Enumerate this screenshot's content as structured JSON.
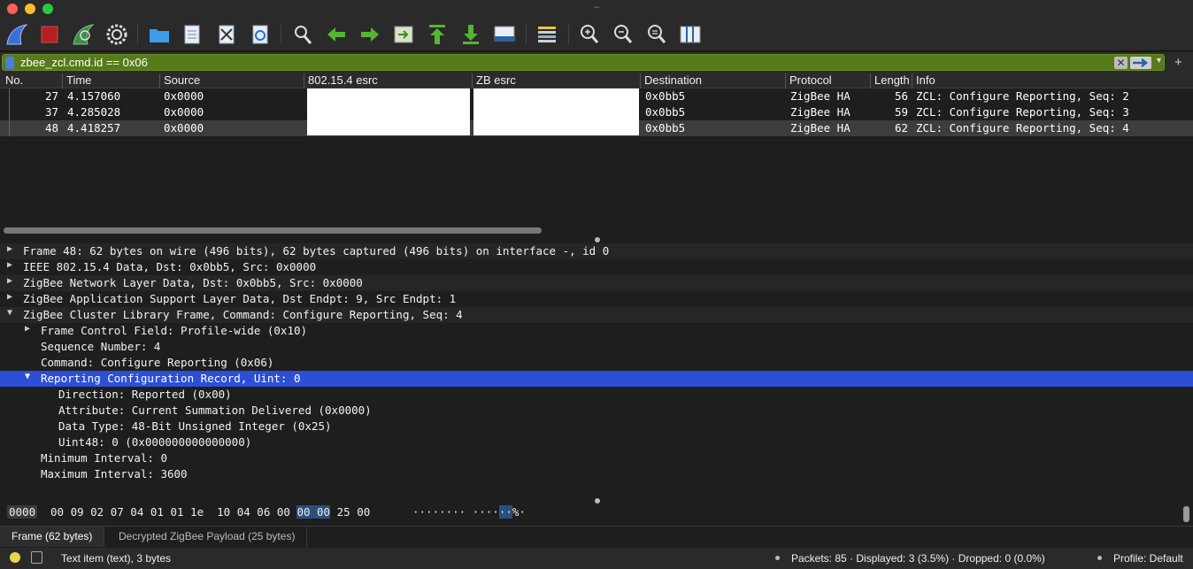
{
  "window": {
    "title": "–"
  },
  "toolbar": {
    "icons": [
      "shark-fin-start-icon",
      "stop-square-icon",
      "shark-fin-restart-icon",
      "gear-icon",
      "folder-open-icon",
      "file-icon",
      "close-file-icon",
      "reload-file-icon",
      "search-icon",
      "arrow-left-icon",
      "arrow-right-icon",
      "go-to-packet-icon",
      "arrow-up-first-icon",
      "arrow-down-last-icon",
      "autoscroll-icon",
      "colorize-icon",
      "zoom-in-icon",
      "zoom-out-icon",
      "zoom-reset-icon",
      "resize-columns-icon"
    ],
    "accent_colors": {
      "fin": "#3b6fd6",
      "stop": "#b32020",
      "green_fin": "#3f8d4a",
      "arrow_green": "#55b534"
    }
  },
  "filter": {
    "value": "zbee_zcl.cmd.id == 0x06",
    "clear_glyph": "✕",
    "add_glyph": "+"
  },
  "packet_list": {
    "columns": [
      "No.",
      "Time",
      "Source",
      "802.15.4 esrc",
      "ZB esrc",
      "Destination",
      "Protocol",
      "Length",
      "Info"
    ],
    "rows": [
      {
        "no": "27",
        "time": "4.157060",
        "source": "0x0000",
        "esrc": "",
        "zbesrc": "",
        "destination": "0x0bb5",
        "protocol": "ZigBee HA",
        "length": "56",
        "info": "ZCL: Configure Reporting, Seq: 2"
      },
      {
        "no": "37",
        "time": "4.285028",
        "source": "0x0000",
        "esrc": "",
        "zbesrc": "",
        "destination": "0x0bb5",
        "protocol": "ZigBee HA",
        "length": "59",
        "info": "ZCL: Configure Reporting, Seq: 3"
      },
      {
        "no": "48",
        "time": "4.418257",
        "source": "0x0000",
        "esrc": "",
        "zbesrc": "",
        "destination": "0x0bb5",
        "protocol": "ZigBee HA",
        "length": "62",
        "info": "ZCL: Configure Reporting, Seq: 4"
      }
    ]
  },
  "details": {
    "frame": "Frame 48: 62 bytes on wire (496 bits), 62 bytes captured (496 bits) on interface -, id 0",
    "ieee": "IEEE 802.15.4 Data, Dst: 0x0bb5, Src: 0x0000",
    "nwk": "ZigBee Network Layer Data, Dst: 0x0bb5, Src: 0x0000",
    "aps": "ZigBee Application Support Layer Data, Dst Endpt: 9, Src Endpt: 1",
    "zcl": "ZigBee Cluster Library Frame, Command: Configure Reporting, Seq: 4",
    "fcf": "Frame Control Field: Profile-wide (0x10)",
    "seq": "Sequence Number: 4",
    "cmd": "Command: Configure Reporting (0x06)",
    "record": "Reporting Configuration Record, Uint: 0",
    "direction": "Direction: Reported (0x00)",
    "attribute": "Attribute: Current Summation Delivered (0x0000)",
    "datatype": "Data Type: 48-Bit Unsigned Integer (0x25)",
    "uint48": "Uint48: 0 (0x000000000000000)",
    "min_interval": "Minimum Interval: 0",
    "max_interval": "Maximum Interval: 3600"
  },
  "hex": {
    "offset": "0000",
    "bytes_before": "00 09 02 07 04 01 01 1e  10 04 06 00 ",
    "bytes_sel": "00 00",
    "bytes_after": " 25 00",
    "ascii_before": "········ ····",
    "ascii_sel": "··",
    "ascii_after": "%·"
  },
  "tabs": [
    "Frame (62 bytes)",
    "Decrypted ZigBee Payload (25 bytes)"
  ],
  "status": {
    "item": "Text item (text), 3 bytes",
    "packets": "Packets: 85 · Displayed: 3 (3.5%) · Dropped: 0 (0.0%)",
    "profile": "Profile: Default"
  }
}
